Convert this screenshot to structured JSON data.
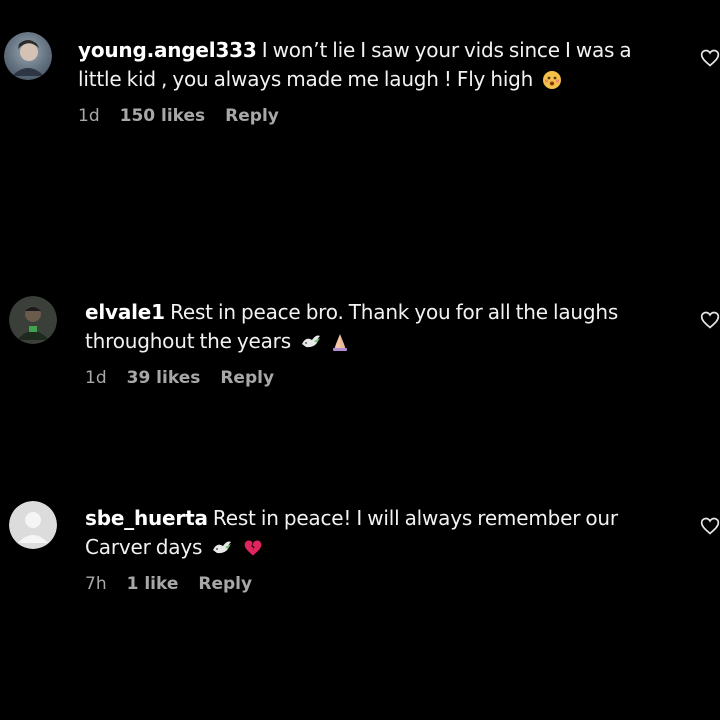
{
  "comments": [
    {
      "username": "young.angel333",
      "text": "I won’t lie I saw your vids since I was a little kid , you always made me laugh ! Fly high",
      "emojis": [
        "hot-face-emoji"
      ],
      "time": "1d",
      "likes": "150 likes",
      "reply": "Reply"
    },
    {
      "username": "elvale1",
      "text": "Rest in peace bro. Thank you for all the laughs throughout the years",
      "emojis": [
        "dove-emoji",
        "praying-hands-emoji"
      ],
      "time": "1d",
      "likes": "39 likes",
      "reply": "Reply"
    },
    {
      "username": "sbe_huerta",
      "text": "Rest in peace! I will always remember our Carver days",
      "emojis": [
        "dove-emoji",
        "broken-heart-emoji"
      ],
      "time": "7h",
      "likes": "1 like",
      "reply": "Reply"
    }
  ],
  "icons": {
    "like": "heart-outline-icon"
  },
  "colors": {
    "background": "#000000",
    "text": "#f2f2f2",
    "meta": "#a8a8a8",
    "broken_heart": "#e0245e"
  }
}
